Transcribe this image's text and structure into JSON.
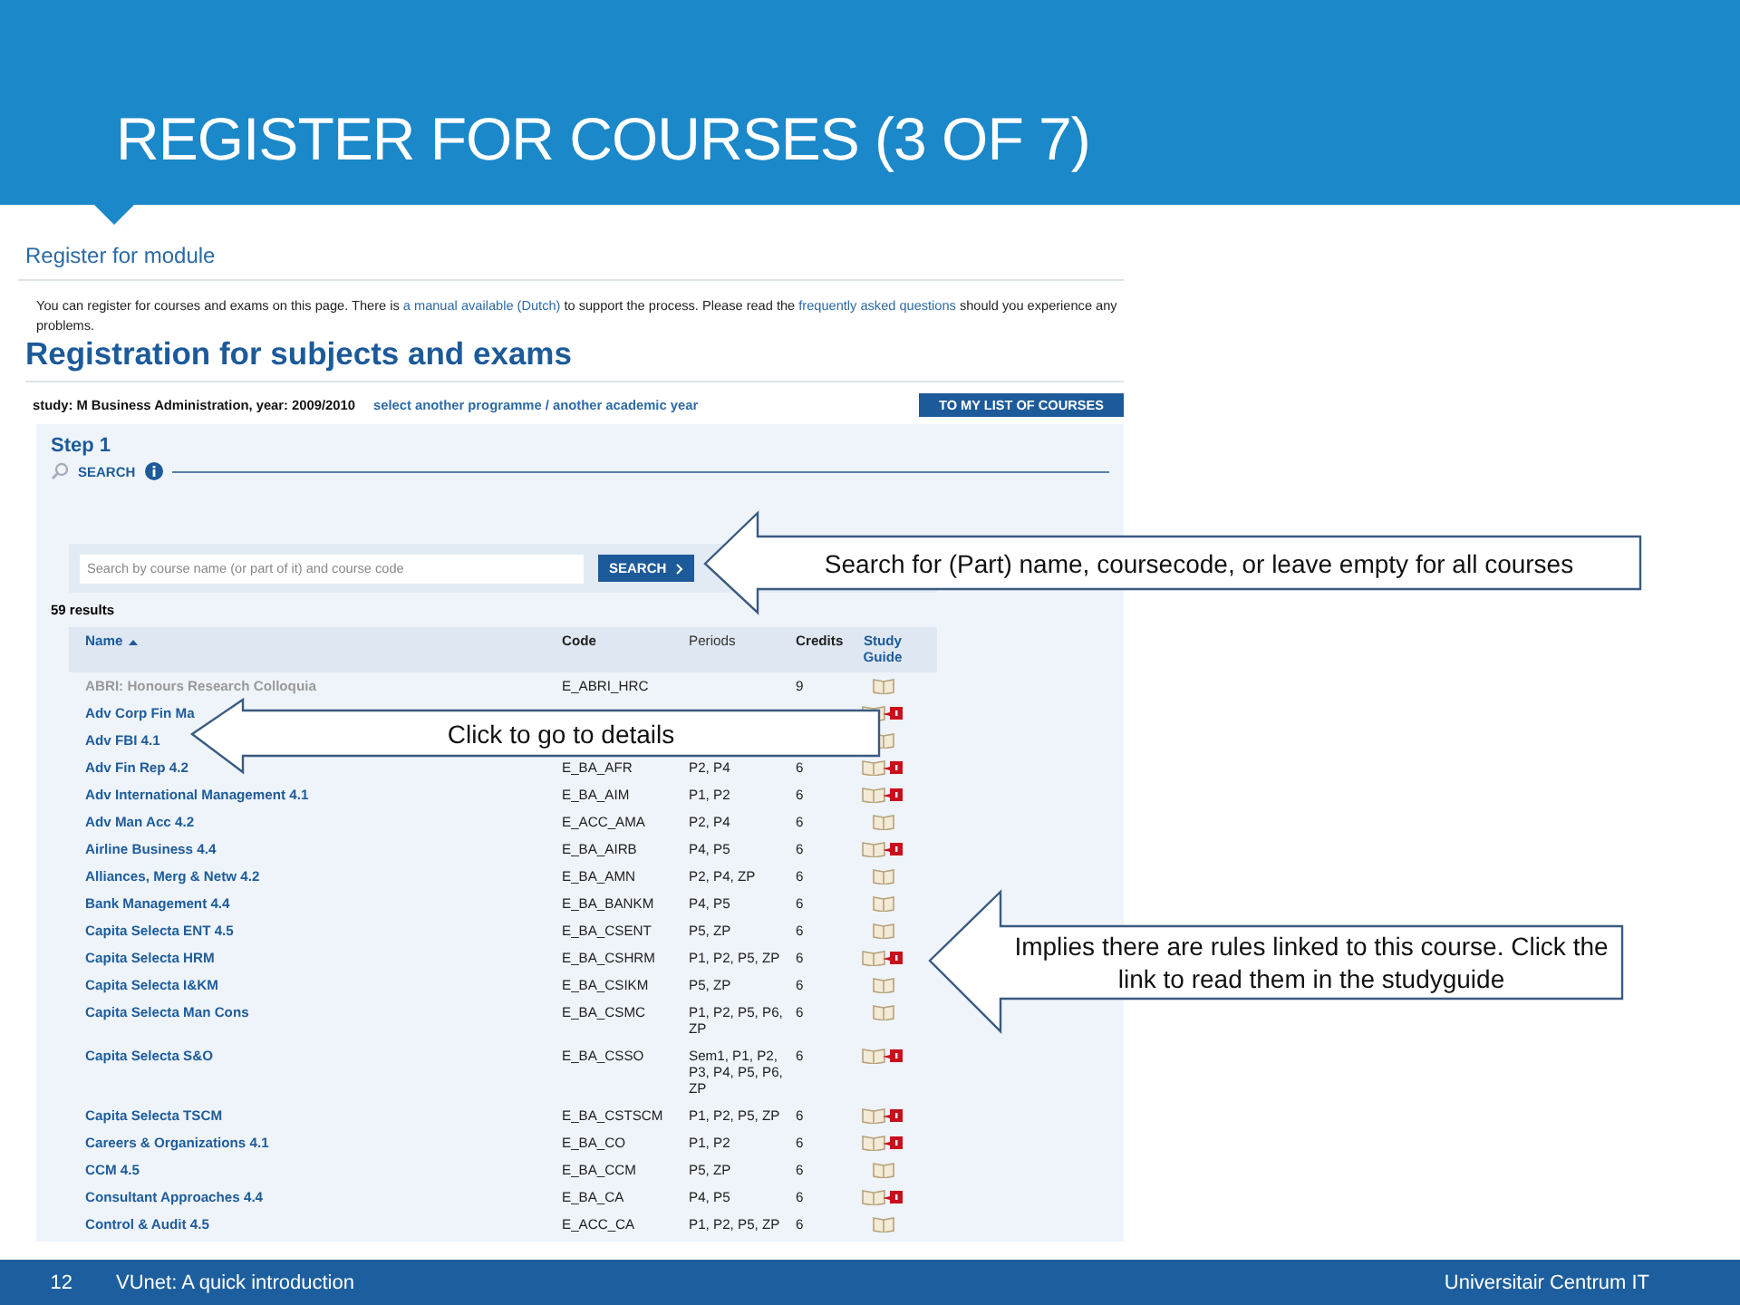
{
  "slide": {
    "title": "REGISTER FOR COURSES (3 OF 7)"
  },
  "page": {
    "heading": "Register for module",
    "intro": {
      "before": "You can register for courses and exams on this page. There is ",
      "link_1": "a manual available (Dutch)",
      "middle": " to support the process. Please read the ",
      "link_2": "frequently asked questions",
      "after": " should you experience any problems."
    },
    "title": "Registration for subjects and exams",
    "study": "study: M Business Administration, year: 2009/2010",
    "change_link": "select another programme / another academic year",
    "list_button": "TO MY LIST OF COURSES",
    "step": "Step 1",
    "section": "SEARCH",
    "search": {
      "placeholder": "Search by course name (or part of it) and course code",
      "button": "SEARCH"
    },
    "results": "59 results",
    "columns": [
      "Name",
      "Code",
      "Periods",
      "Credits",
      "Study Guide"
    ],
    "rows": [
      {
        "name": "ABRI: Honours Research Colloquia",
        "code": "E_ABRI_HRC",
        "periods": "",
        "credits": "9",
        "disabled": true,
        "has_rules": false
      },
      {
        "name": "Adv Corp Fin Ma",
        "code": "",
        "periods": "",
        "credits": "",
        "disabled": false,
        "has_rules": true
      },
      {
        "name": "Adv FBI 4.1",
        "code": "",
        "periods": "",
        "credits": "",
        "disabled": false,
        "has_rules": false
      },
      {
        "name": "Adv Fin Rep 4.2",
        "code": "E_BA_AFR",
        "periods": "P2, P4",
        "credits": "6",
        "disabled": false,
        "has_rules": true
      },
      {
        "name": "Adv International Management 4.1",
        "code": "E_BA_AIM",
        "periods": "P1, P2",
        "credits": "6",
        "disabled": false,
        "has_rules": true
      },
      {
        "name": "Adv Man Acc 4.2",
        "code": "E_ACC_AMA",
        "periods": "P2, P4",
        "credits": "6",
        "disabled": false,
        "has_rules": false
      },
      {
        "name": "Airline Business 4.4",
        "code": "E_BA_AIRB",
        "periods": "P4, P5",
        "credits": "6",
        "disabled": false,
        "has_rules": true
      },
      {
        "name": "Alliances, Merg & Netw 4.2",
        "code": "E_BA_AMN",
        "periods": "P2, P4, ZP",
        "credits": "6",
        "disabled": false,
        "has_rules": false
      },
      {
        "name": "Bank Management 4.4",
        "code": "E_BA_BANKM",
        "periods": "P4, P5",
        "credits": "6",
        "disabled": false,
        "has_rules": false
      },
      {
        "name": "Capita Selecta ENT 4.5",
        "code": "E_BA_CSENT",
        "periods": "P5, ZP",
        "credits": "6",
        "disabled": false,
        "has_rules": false
      },
      {
        "name": "Capita Selecta HRM",
        "code": "E_BA_CSHRM",
        "periods": "P1, P2, P5, ZP",
        "credits": "6",
        "disabled": false,
        "has_rules": true
      },
      {
        "name": "Capita Selecta I&KM",
        "code": "E_BA_CSIKM",
        "periods": "P5, ZP",
        "credits": "6",
        "disabled": false,
        "has_rules": false
      },
      {
        "name": "Capita Selecta Man Cons",
        "code": "E_BA_CSMC",
        "periods": "P1, P2, P5, P6, ZP",
        "credits": "6",
        "disabled": false,
        "has_rules": false
      },
      {
        "name": "Capita Selecta S&O",
        "code": "E_BA_CSSO",
        "periods": "Sem1, P1, P2, P3, P4, P5, P6, ZP",
        "credits": "6",
        "disabled": false,
        "has_rules": true
      },
      {
        "name": "Capita Selecta TSCM",
        "code": "E_BA_CSTSCM",
        "periods": "P1, P2, P5, ZP",
        "credits": "6",
        "disabled": false,
        "has_rules": true
      },
      {
        "name": "Careers & Organizations 4.1",
        "code": "E_BA_CO",
        "periods": "P1, P2",
        "credits": "6",
        "disabled": false,
        "has_rules": true
      },
      {
        "name": "CCM 4.5",
        "code": "E_BA_CCM",
        "periods": "P5, ZP",
        "credits": "6",
        "disabled": false,
        "has_rules": false
      },
      {
        "name": "Consultant Approaches 4.4",
        "code": "E_BA_CA",
        "periods": "P4, P5",
        "credits": "6",
        "disabled": false,
        "has_rules": true
      },
      {
        "name": "Control & Audit 4.5",
        "code": "E_ACC_CA",
        "periods": "P1, P2, P5, ZP",
        "credits": "6",
        "disabled": false,
        "has_rules": false
      }
    ]
  },
  "callouts": [
    {
      "text": "Search for (Part) name, coursecode, or leave empty for all courses"
    },
    {
      "text": "Click to go to details"
    },
    {
      "text": "Implies there are rules linked to this course. Click the link to read them in the studyguide"
    }
  ],
  "footer": {
    "page_number": "12",
    "title": "VUnet: A quick introduction",
    "organization": "Universitair Centrum IT"
  }
}
